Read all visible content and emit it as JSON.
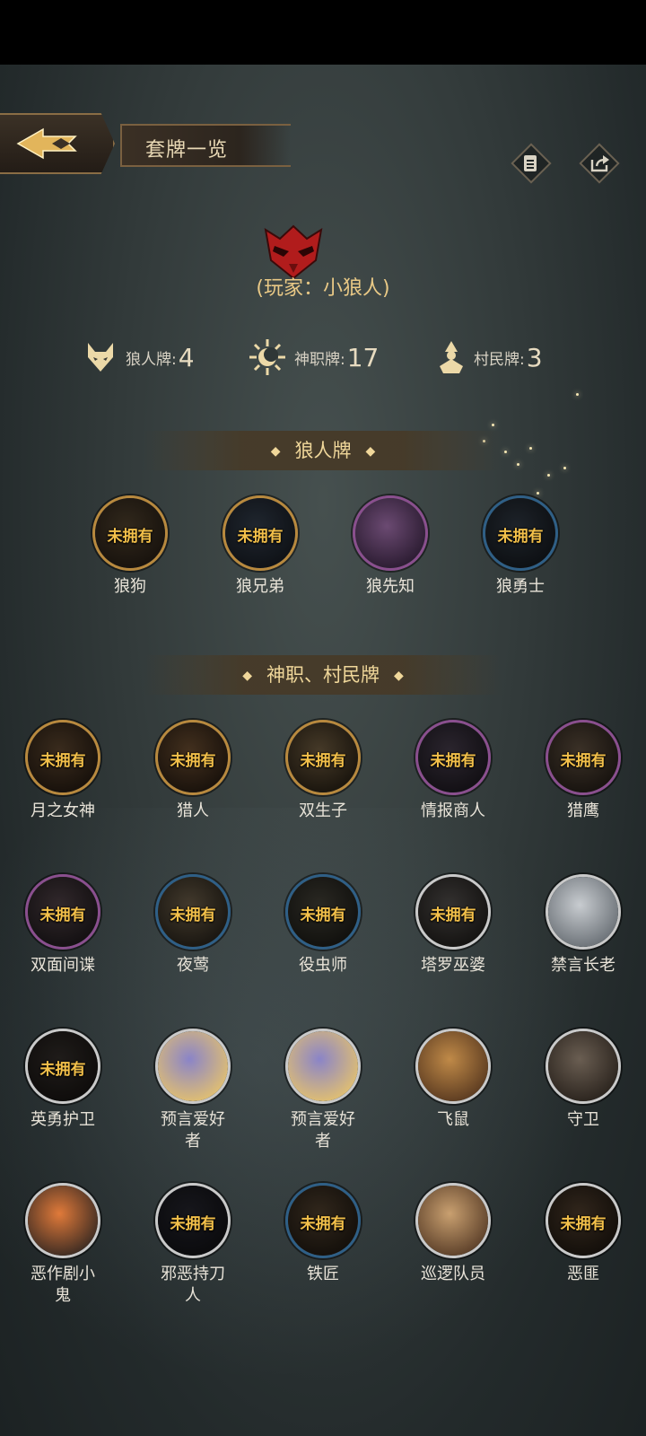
{
  "header": {
    "title": "套牌一览"
  },
  "player": {
    "label": "(玩家：小狼人)"
  },
  "stats": [
    {
      "label": "狼人牌:",
      "value": "4",
      "icon": "wolf-icon"
    },
    {
      "label": "神职牌:",
      "value": "17",
      "icon": "sun-moon-icon"
    },
    {
      "label": "村民牌:",
      "value": "3",
      "icon": "villager-icon"
    }
  ],
  "sections": {
    "wolf": "狼人牌",
    "gods": "神职、村民牌"
  },
  "not_owned_label": "未拥有",
  "wolf_cards": [
    {
      "name": "狼狗",
      "owned": false
    },
    {
      "name": "狼兄弟",
      "owned": false
    },
    {
      "name": "狼先知",
      "owned": true
    },
    {
      "name": "狼勇士",
      "owned": false
    }
  ],
  "god_cards": [
    {
      "name": "月之女神",
      "owned": false
    },
    {
      "name": "猎人",
      "owned": false
    },
    {
      "name": "双生子",
      "owned": false
    },
    {
      "name": "情报商人",
      "owned": false
    },
    {
      "name": "猎鹰",
      "owned": false
    },
    {
      "name": "双面间谍",
      "owned": false
    },
    {
      "name": "夜莺",
      "owned": false
    },
    {
      "name": "役虫师",
      "owned": false
    },
    {
      "name": "塔罗巫婆",
      "owned": false
    },
    {
      "name": "禁言长老",
      "owned": true
    },
    {
      "name": "英勇护卫",
      "owned": false
    },
    {
      "name": "预言爱好者",
      "owned": true
    },
    {
      "name": "预言爱好者",
      "owned": true
    },
    {
      "name": "飞鼠",
      "owned": true
    },
    {
      "name": "守卫",
      "owned": true
    },
    {
      "name": "恶作剧小鬼",
      "owned": true
    },
    {
      "name": "邪恶持刀人",
      "owned": false
    },
    {
      "name": "铁匠",
      "owned": false
    },
    {
      "name": "巡逻队员",
      "owned": true
    },
    {
      "name": "恶匪",
      "owned": false
    }
  ]
}
